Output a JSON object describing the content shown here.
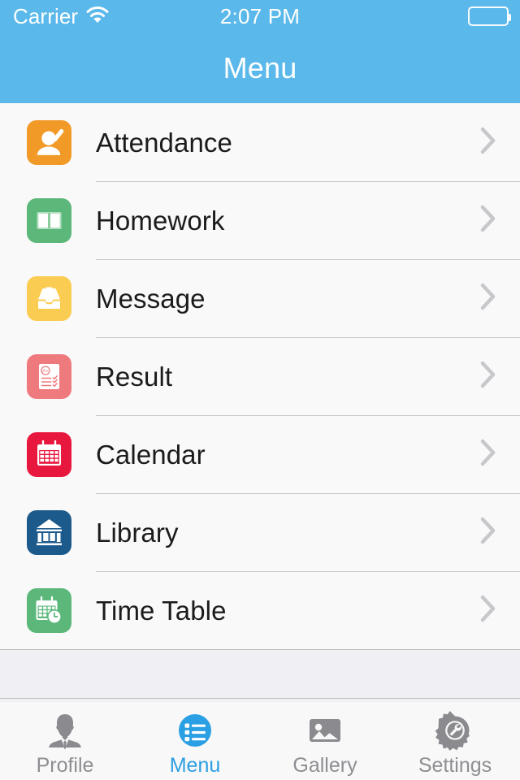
{
  "status_bar": {
    "carrier": "Carrier",
    "wifi_icon": "wifi-icon",
    "time": "2:07 PM",
    "battery_icon": "battery-full-icon"
  },
  "nav": {
    "title": "Menu"
  },
  "colors": {
    "header": "#5bb8ea",
    "accent": "#2b9fe3",
    "list_bg": "#f9f9f9",
    "gap_bg": "#efeff4",
    "tabbar_bg": "#f8f8f8",
    "separator": "#c8c7cc",
    "label": "#1b1b1b",
    "inactive_tab": "#8e8e93",
    "chevron": "#c7c7cc"
  },
  "menu": {
    "items": [
      {
        "label": "Attendance",
        "icon": "attendance-icon",
        "color": "#f29a27",
        "accessory": "chevron-right-icon"
      },
      {
        "label": "Homework",
        "icon": "homework-icon",
        "color": "#5cb87a",
        "accessory": "chevron-right-icon"
      },
      {
        "label": "Message",
        "icon": "message-icon",
        "color": "#fbcc52",
        "accessory": "chevron-right-icon"
      },
      {
        "label": "Result",
        "icon": "result-icon",
        "color": "#ef7a7e",
        "accessory": "chevron-right-icon"
      },
      {
        "label": "Calendar",
        "icon": "calendar-icon",
        "color": "#e8173d",
        "accessory": "chevron-right-icon"
      },
      {
        "label": "Library",
        "icon": "library-icon",
        "color": "#1c5a8c",
        "accessory": "chevron-right-icon"
      },
      {
        "label": "Time Table",
        "icon": "time-table-icon",
        "color": "#5cb87a",
        "accessory": "chevron-right-icon"
      }
    ]
  },
  "tabbar": {
    "tabs": [
      {
        "label": "Profile",
        "icon": "profile-icon",
        "active": false
      },
      {
        "label": "Menu",
        "icon": "menu-list-icon",
        "active": true
      },
      {
        "label": "Gallery",
        "icon": "gallery-icon",
        "active": false
      },
      {
        "label": "Settings",
        "icon": "settings-gear-icon",
        "active": false
      }
    ]
  }
}
